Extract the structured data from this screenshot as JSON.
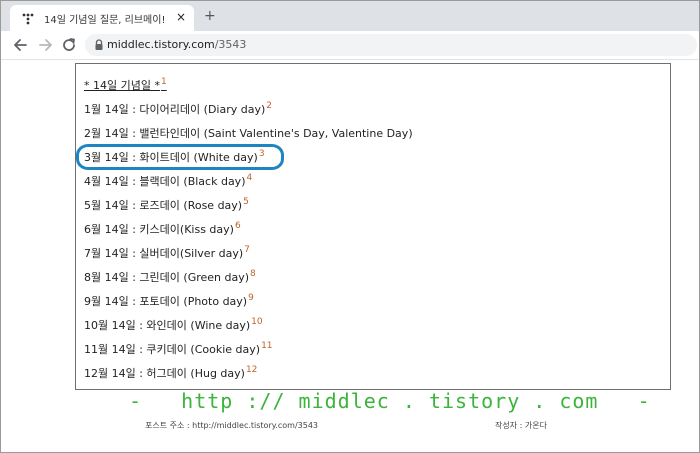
{
  "tab": {
    "title": "14일 기념일 질문, 리브메이!",
    "close": "×",
    "new_tab": "+"
  },
  "address_bar": {
    "host": "middlec.tistory.com",
    "path": "/3543"
  },
  "list": {
    "heading": "* 14일 기념일 *",
    "heading_fn": "1",
    "items": [
      {
        "text": "1월 14일 : 다이어리데이 (Diary day)",
        "fn": "2"
      },
      {
        "text": "2월 14일 : 밸런타인데이 (Saint Valentine's Day, Valentine Day)",
        "fn": ""
      },
      {
        "text": "3월 14일 : 화이트데이 (White day)",
        "fn": "3"
      },
      {
        "text": "4월 14일 : 블랙데이 (Black day)",
        "fn": "4"
      },
      {
        "text": "5월 14일 : 로즈데이 (Rose day)",
        "fn": "5"
      },
      {
        "text": "6월 14일 : 키스데이(Kiss day)",
        "fn": "6"
      },
      {
        "text": "7월 14일 : 실버데이(Silver day)",
        "fn": "7"
      },
      {
        "text": "8월 14일 : 그린데이 (Green day)",
        "fn": "8"
      },
      {
        "text": "9월 14일 : 포토데이 (Photo day)",
        "fn": "9"
      },
      {
        "text": "10월 14일 : 와인데이 (Wine day)",
        "fn": "10"
      },
      {
        "text": "11월 14일 : 쿠키데이 (Cookie day)",
        "fn": "11"
      },
      {
        "text": "12월 14일 : 허그데이 (Hug day)",
        "fn": "12"
      }
    ],
    "highlighted_item": "3월 14일 : 화이트데이 (White day)"
  },
  "footer": {
    "watermark": "-   http :// middlec . tistory . com   -",
    "post_address": "포스트 주소 : http://middlec.tistory.com/3543",
    "author": "작성자 : 가온다"
  },
  "colors": {
    "watermark": "#3bb43b",
    "footnote": "#c0622a",
    "highlight": "#1f85c2"
  }
}
